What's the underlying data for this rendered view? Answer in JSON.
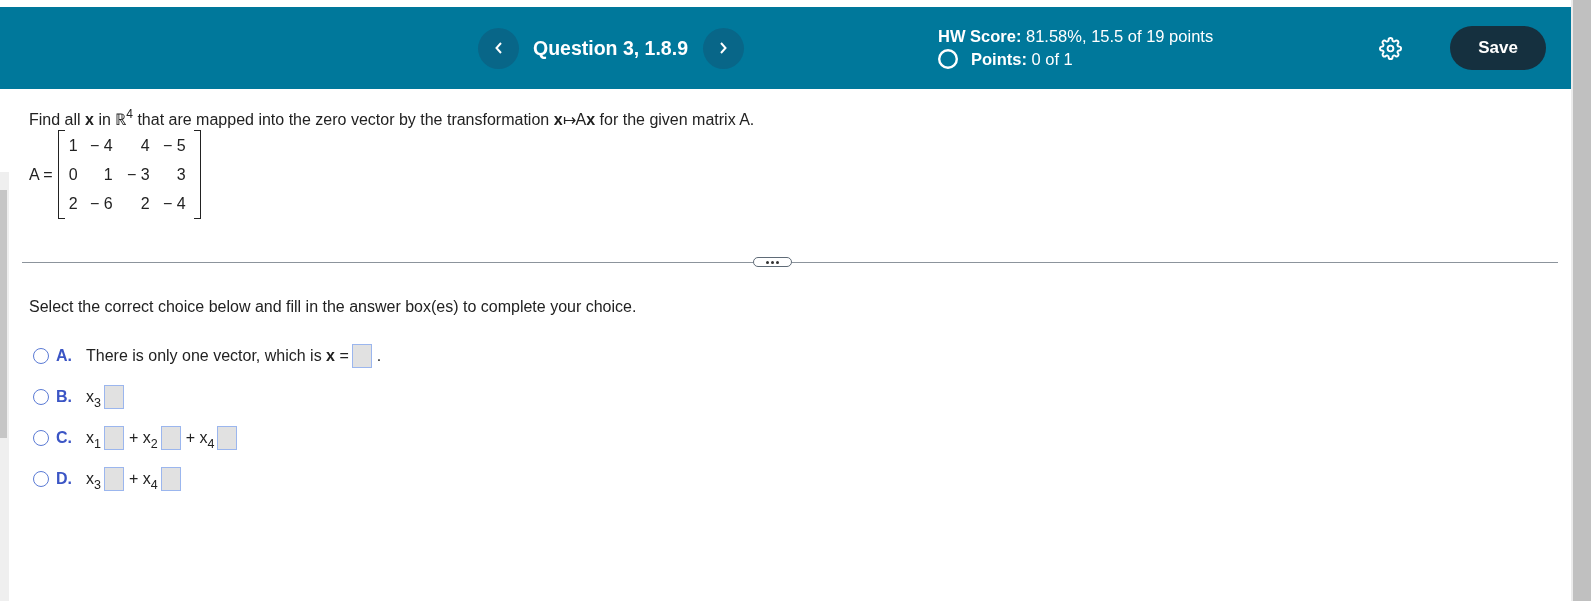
{
  "header": {
    "question_title": "Question 3, 1.8.9",
    "hw_score": "**HW Score:** 81.58%, 15.5 of 19 points",
    "points": "**Points:** 0 of 1",
    "save_button": "Save"
  },
  "question": {
    "prompt": "Find all **x** in ℝ$^{4}$ that are mapped into the zero vector by the transformation **x**↦A**x** for the given matrix A.",
    "matrix": {
      "label": "A =",
      "rows": [
        [
          "1",
          "− 4",
          "4",
          "− 5"
        ],
        [
          "0",
          "1",
          "− 3",
          "3"
        ],
        [
          "2",
          "− 6",
          "2",
          "− 4"
        ]
      ]
    }
  },
  "instruction": "Select the correct choice below and fill in the answer box(es) to complete your choice.",
  "choices": [
    {
      "letter": "A.",
      "selected": false,
      "parts": [
        {
          "kind": "text",
          "text": "There is only one vector, which is **x** ="
        },
        {
          "kind": "box"
        },
        {
          "kind": "text",
          "text": "."
        }
      ]
    },
    {
      "letter": "B.",
      "selected": false,
      "parts": [
        {
          "kind": "text",
          "text": "x$_{3}$"
        },
        {
          "kind": "box"
        }
      ]
    },
    {
      "letter": "C.",
      "selected": false,
      "parts": [
        {
          "kind": "text",
          "text": "x$_{1}$"
        },
        {
          "kind": "box"
        },
        {
          "kind": "text",
          "text": "+ x$_{2}$"
        },
        {
          "kind": "box"
        },
        {
          "kind": "text",
          "text": "+ x$_{4}$"
        },
        {
          "kind": "box"
        }
      ]
    },
    {
      "letter": "D.",
      "selected": false,
      "parts": [
        {
          "kind": "text",
          "text": "x$_{3}$"
        },
        {
          "kind": "box"
        },
        {
          "kind": "text",
          "text": "+ x$_{4}$"
        },
        {
          "kind": "box"
        }
      ]
    }
  ]
}
